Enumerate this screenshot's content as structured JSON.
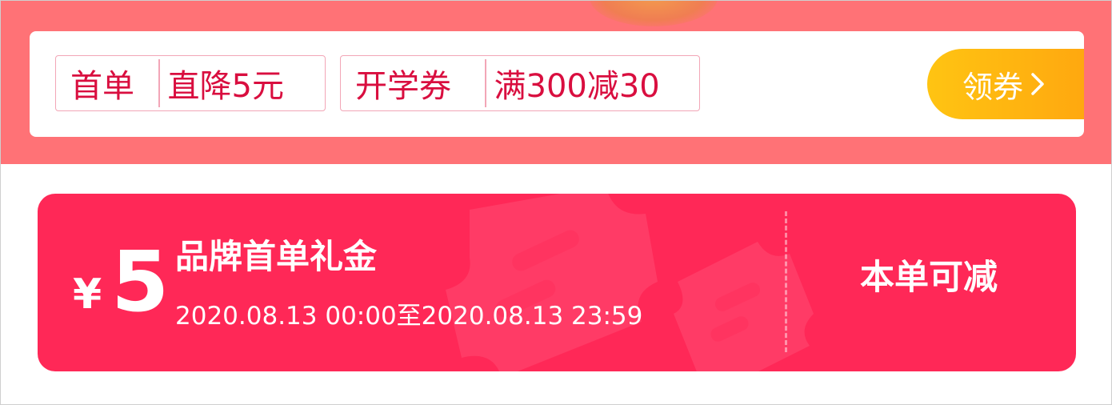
{
  "promo_bar": {
    "tags": [
      {
        "label": "首单",
        "value": "直降5元"
      },
      {
        "label": "开学券",
        "value": "满300减30"
      }
    ],
    "get_coupon_label": "领券"
  },
  "gift_card": {
    "currency_symbol": "¥",
    "amount": "5",
    "title": "品牌首单礼金",
    "validity": "2020.08.13 00:00至2020.08.13 23:59",
    "action_label": "本单可减"
  },
  "colors": {
    "band": "#ff7276",
    "card_red": "#ff2857",
    "tag_text": "#d90e3f",
    "button_yellow": "#ffc412"
  },
  "icons": {
    "coupon_button_arrow": "chevron-right-icon",
    "card_background": "ticket-watermark-icon"
  }
}
